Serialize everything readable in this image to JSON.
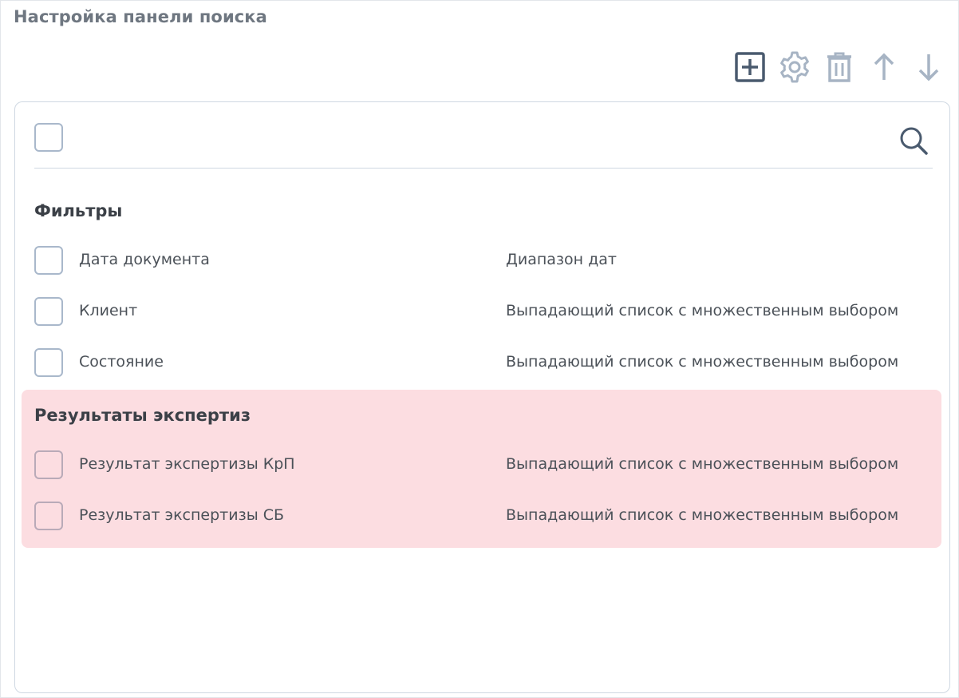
{
  "page": {
    "title": "Настройка панели поиска"
  },
  "toolbar": {
    "add": "plus-square-icon",
    "settings": "gear-icon",
    "delete": "trash-icon",
    "move_up": "arrow-up-icon",
    "move_down": "arrow-down-icon"
  },
  "search": {
    "value": "",
    "placeholder": ""
  },
  "groups": [
    {
      "title": "Фильтры",
      "highlighted": false,
      "items": [
        {
          "label": "Дата документа",
          "type": "Диапазон дат",
          "checked": false
        },
        {
          "label": "Клиент",
          "type": "Выпадающий список с множественным выбором",
          "checked": false
        },
        {
          "label": "Состояние",
          "type": "Выпадающий список с множественным выбором",
          "checked": false
        }
      ]
    },
    {
      "title": "Результаты экспертиз",
      "highlighted": true,
      "items": [
        {
          "label": "Результат экспертизы КрП",
          "type": "Выпадающий список с множественным выбором",
          "checked": false
        },
        {
          "label": "Результат экспертизы СБ",
          "type": "Выпадающий список с множественным выбором",
          "checked": false
        }
      ]
    }
  ],
  "colors": {
    "highlight": "#fcdde1",
    "checkbox_border": "#a9b8cb",
    "title": "#6f7781",
    "text": "#4b5158"
  }
}
